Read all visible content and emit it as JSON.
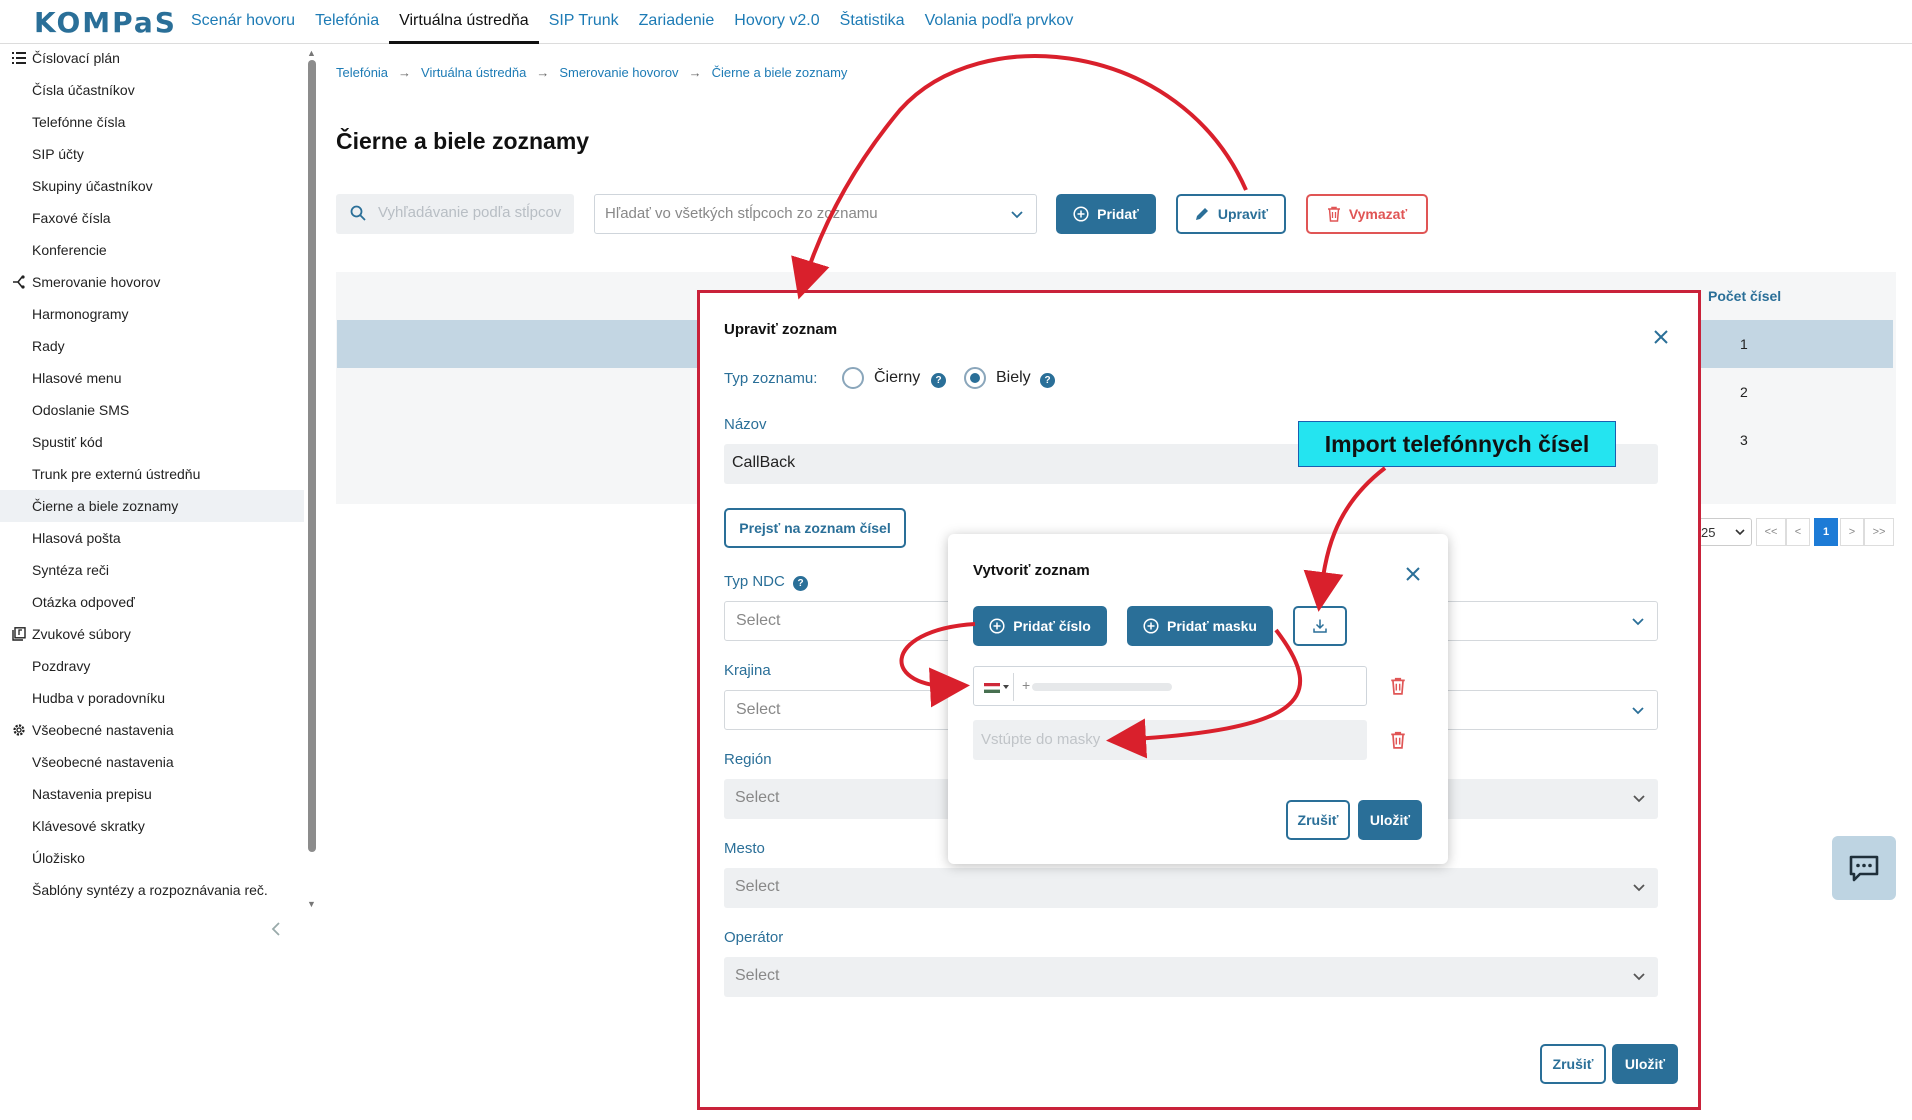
{
  "app": {
    "logo": "KOMPaS"
  },
  "nav": [
    "Scenár hovoru",
    "Telefónia",
    "Virtuálna ústredňa",
    "SIP Trunk",
    "Zariadenie",
    "Hovory v2.0",
    "Štatistika",
    "Volania podľa prvkov"
  ],
  "nav_active": "Virtuálna ústredňa",
  "sidebar": {
    "sections": [
      {
        "title": "Číslovací plán",
        "icon": "list-icon",
        "items": [
          "Čísla účastníkov",
          "Telefónne čísla",
          "SIP účty",
          "Skupiny účastníkov",
          "Faxové čísla",
          "Konferencie"
        ]
      },
      {
        "title": "Smerovanie hovorov",
        "icon": "routing-icon",
        "items": [
          "Harmonogramy",
          "Rady",
          "Hlasové menu",
          "Odoslanie SMS",
          "Spustiť kód",
          "Trunk pre externú ústredňu",
          "Čierne a biele zoznamy",
          "Hlasová pošta",
          "Syntéza reči",
          "Otázka odpoveď"
        ]
      },
      {
        "title": "Zvukové súbory",
        "icon": "audio-files-icon",
        "items": [
          "Pozdravy",
          "Hudba v poradovníku"
        ]
      },
      {
        "title": "Všeobecné nastavenia",
        "icon": "gear-icon",
        "items": [
          "Všeobecné nastavenia",
          "Nastavenia prepisu",
          "Klávesové skratky",
          "Úložisko",
          "Šablóny syntézy a rozpoznávania reč."
        ]
      }
    ],
    "selected": "Čierne a biele zoznamy"
  },
  "breadcrumb": [
    "Telefónia",
    "Virtuálna ústredňa",
    "Smerovanie hovorov",
    "Čierne a biele zoznamy"
  ],
  "page_title": "Čierne a biele zoznamy",
  "toolbar": {
    "search_placeholder": "Vyhľadávanie podľa stĺpcov",
    "filter_placeholder": "Hľadať vo všetkých stĺpcoch zo zoznamu",
    "add_label": "Pridať",
    "edit_label": "Upraviť",
    "delete_label": "Vymazať"
  },
  "table": {
    "count_header": "Počet čísel",
    "counts": [
      "1",
      "2",
      "3"
    ]
  },
  "pagination": {
    "page_size": "25",
    "first": "<<",
    "prev": "<",
    "current": "1",
    "next": ">",
    "last": ">>"
  },
  "edit_modal": {
    "title": "Upraviť zoznam",
    "list_type_label": "Typ zoznamu:",
    "options": [
      "Čierny",
      "Biely"
    ],
    "selected_option": "Biely",
    "name_label": "Názov",
    "name_value": "CallBack",
    "go_to_numbers_label": "Prejsť na zoznam čísel",
    "ndc_label": "Typ NDC",
    "country_label": "Krajina",
    "region_label": "Región",
    "city_label": "Mesto",
    "operator_label": "Operátor",
    "select_placeholder": "Select",
    "cancel_label": "Zrušiť",
    "save_label": "Uložiť"
  },
  "create_modal": {
    "title": "Vytvoriť zoznam",
    "add_number_label": "Pridať číslo",
    "add_mask_label": "Pridať masku",
    "phone_prefix": "+",
    "mask_placeholder": "Vstúpte do masky",
    "cancel_label": "Zrušiť",
    "save_label": "Uložiť"
  },
  "callout": {
    "text": "Import telefónnych čísel"
  },
  "colors": {
    "primary": "#2a6f98",
    "link": "#1d7bb5",
    "danger": "#e05555",
    "annotation": "#d9202c",
    "callout": "#24e4f0"
  }
}
